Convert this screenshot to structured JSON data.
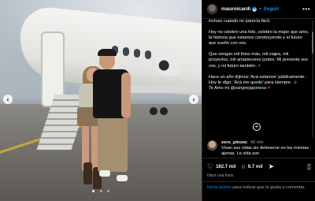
{
  "post": {
    "username": "mauroicardi",
    "separator": "•",
    "follow_label": "Seguir",
    "more_icon": "•••",
    "caption": {
      "line1": "incluso cuando no parecía fácil.",
      "line2": "Hoy no celebro una foto, celebro la mujer que amo, la historia que estamos construyendo y el futuro que sueño con vos.",
      "line3": "Que vengan mil fotos más, mil viajes, mil proyectos, mil amaneceres juntos. Mi presente sos vos, y mi futuro también.",
      "line3_emoji": "♥",
      "line4_a": "Hace un año dijimos 'Acá estamos' públicamente.",
      "line4_b": "Hoy te digo, 'Acá me quedo' para siempre.",
      "line4_emoji": "☺",
      "line4_c": "Te Amo mi",
      "line4_mention": "@sangrejaponesa",
      "line4_end_emoji": "♥"
    },
    "plus_icon": "+",
    "comment": {
      "user": "vero_pinooc",
      "time": "49 min",
      "text": "Vivan sus vidas sin detenerse en las mismas ajenas. La vida son"
    },
    "likes": "192.7 mil",
    "comments": "6.7 mil",
    "like_icon": "♡",
    "comment_icon": "○",
    "share_icon": "➤",
    "save_icon": "▯",
    "timestamp": "Hace una hora",
    "login_link": "Inicia sesión",
    "login_text": "para indicar que te gusta o comentar."
  },
  "carousel": {
    "prev_icon": "‹",
    "next_icon": "›"
  },
  "colors": {
    "accent": "#0095f6",
    "background": "#000000",
    "verified": "#3897f0"
  }
}
